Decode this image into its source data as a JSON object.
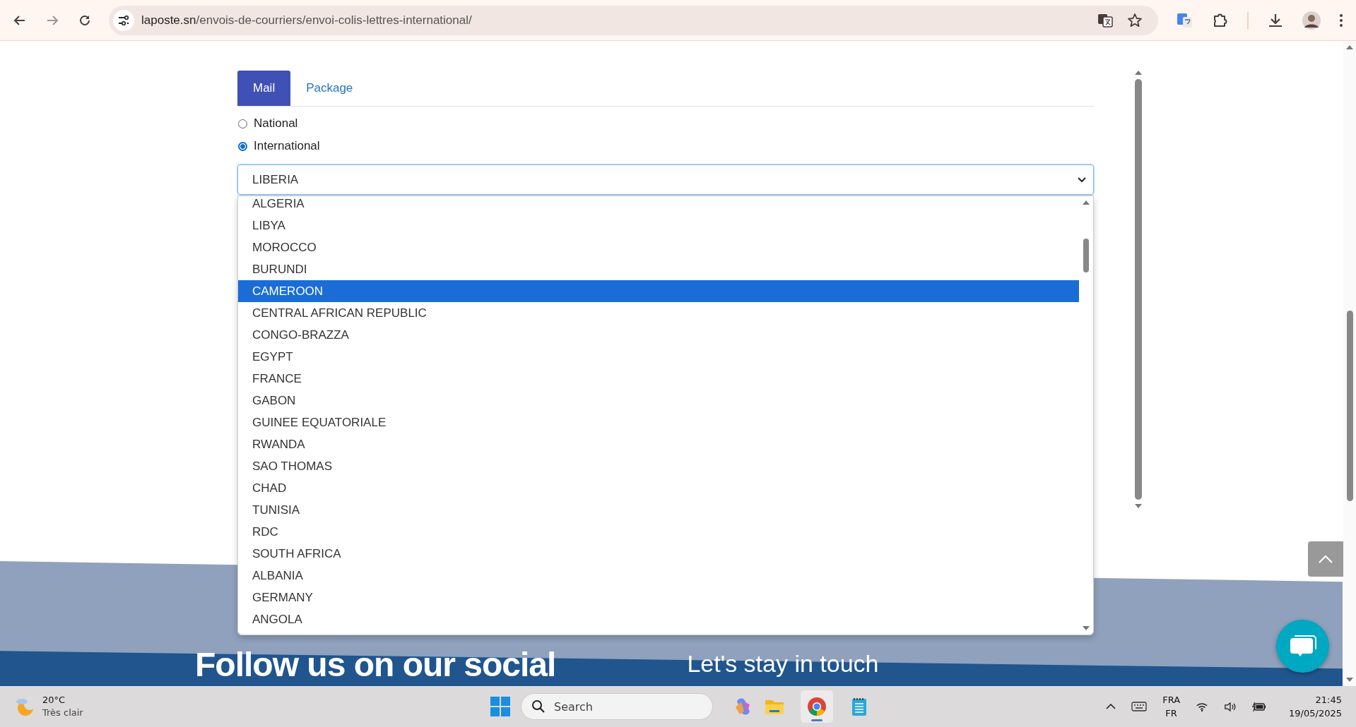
{
  "browser": {
    "url_host": "laposte.sn",
    "url_path": "/envois-de-courriers/envoi-colis-lettres-international/"
  },
  "tabs": [
    {
      "label": "Mail",
      "selected": true
    },
    {
      "label": "Package",
      "selected": false
    }
  ],
  "destination": [
    {
      "label": "National",
      "selected": false
    },
    {
      "label": "International",
      "selected": true
    }
  ],
  "country_select": {
    "value": "LIBERIA",
    "expanded": true,
    "options": [
      {
        "label": "ALGERIA",
        "selected": false
      },
      {
        "label": "LIBYA",
        "selected": false
      },
      {
        "label": "MOROCCO",
        "selected": false
      },
      {
        "label": "BURUNDI",
        "selected": false
      },
      {
        "label": "CAMEROON",
        "selected": true
      },
      {
        "label": "CENTRAL AFRICAN REPUBLIC",
        "selected": false
      },
      {
        "label": "CONGO-BRAZZA",
        "selected": false
      },
      {
        "label": "EGYPT",
        "selected": false
      },
      {
        "label": "FRANCE",
        "selected": false
      },
      {
        "label": "GABON",
        "selected": false
      },
      {
        "label": "GUINEE EQUATORIALE",
        "selected": false
      },
      {
        "label": "RWANDA",
        "selected": false
      },
      {
        "label": "SAO THOMAS",
        "selected": false
      },
      {
        "label": "CHAD",
        "selected": false
      },
      {
        "label": "TUNISIA",
        "selected": false
      },
      {
        "label": "RDC",
        "selected": false
      },
      {
        "label": "SOUTH AFRICA",
        "selected": false
      },
      {
        "label": "ALBANIA",
        "selected": false
      },
      {
        "label": "GERMANY",
        "selected": false
      },
      {
        "label": "ANGOLA",
        "selected": false
      }
    ]
  },
  "footer": {
    "social_heading": "Follow us on our social",
    "contact_heading": "Let's stay in touch"
  },
  "taskbar": {
    "weather": {
      "temperature": "20°C",
      "condition": "Très clair"
    },
    "search": {
      "placeholder": "Search"
    },
    "language": {
      "input": "FRA",
      "layout": "FR"
    },
    "time": "21:45",
    "date": "19/05/2025"
  }
}
